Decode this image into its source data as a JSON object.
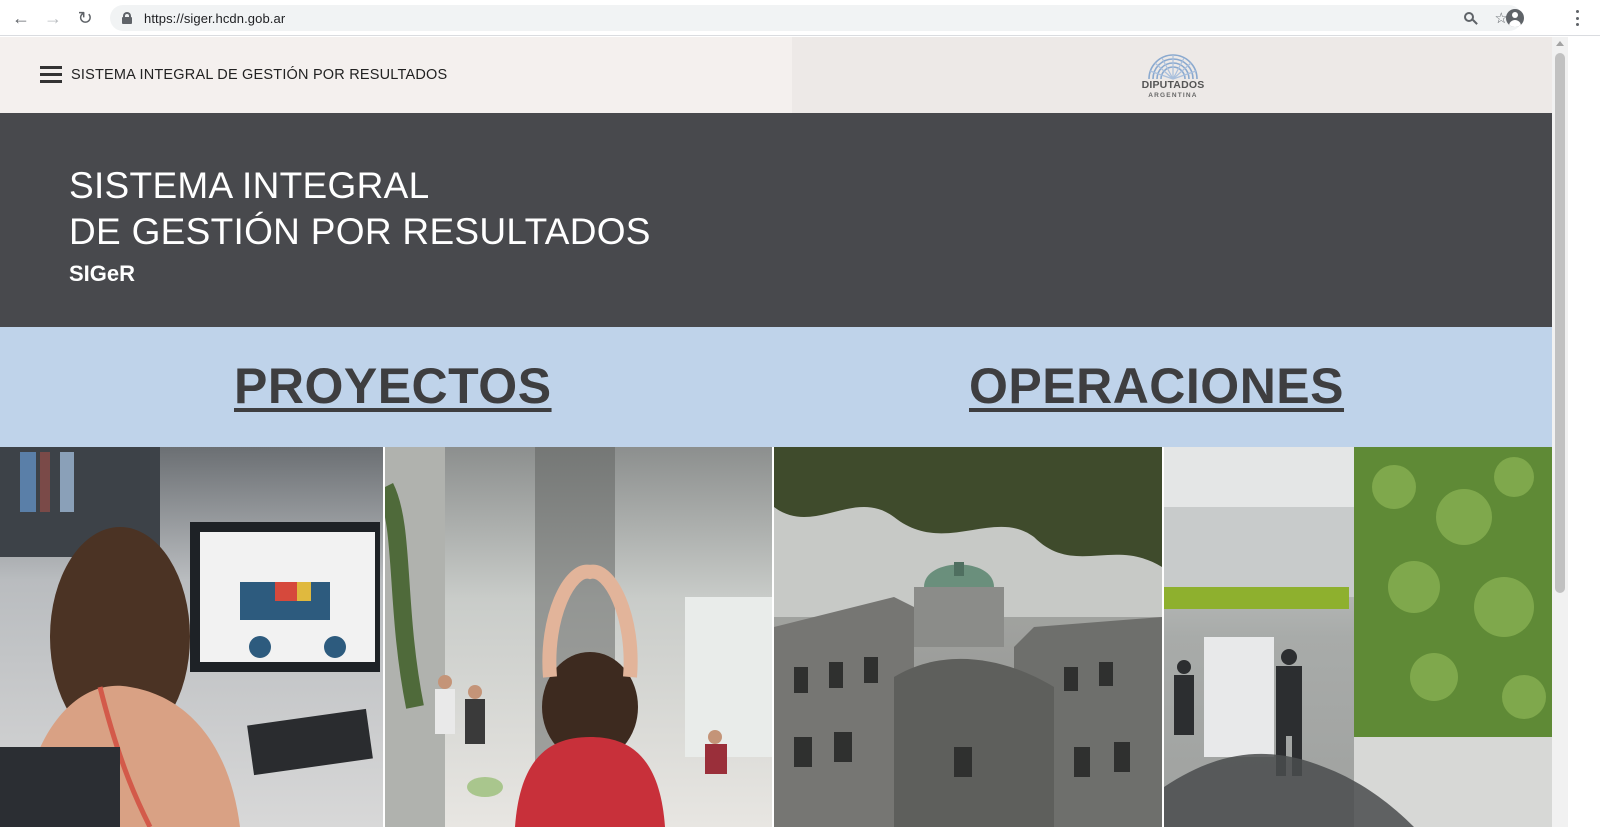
{
  "browser": {
    "url": "https://siger.hcdn.gob.ar",
    "icons": [
      "back-icon",
      "forward-icon",
      "reload-icon",
      "lock-icon",
      "zoom-icon",
      "star-icon",
      "profile-icon",
      "menu-dots-icon"
    ]
  },
  "header": {
    "site_title": "SISTEMA INTEGRAL DE GESTIÓN POR RESULTADOS",
    "logo_line1": "DIPUTADOS",
    "logo_line2": "ARGENTINA"
  },
  "hero": {
    "line1": "SISTEMA INTEGRAL",
    "line2": "DE GESTIÓN POR RESULTADOS",
    "abbr": "SIGeR"
  },
  "sections": {
    "projects": "PROYECTOS",
    "operations": "OPERACIONES"
  },
  "colors": {
    "header_left": "#f4f0ee",
    "header_right": "#ede9e7",
    "hero_bg": "#48494d",
    "band_bg": "#bfd3ea",
    "section_link": "#3e3e40"
  }
}
